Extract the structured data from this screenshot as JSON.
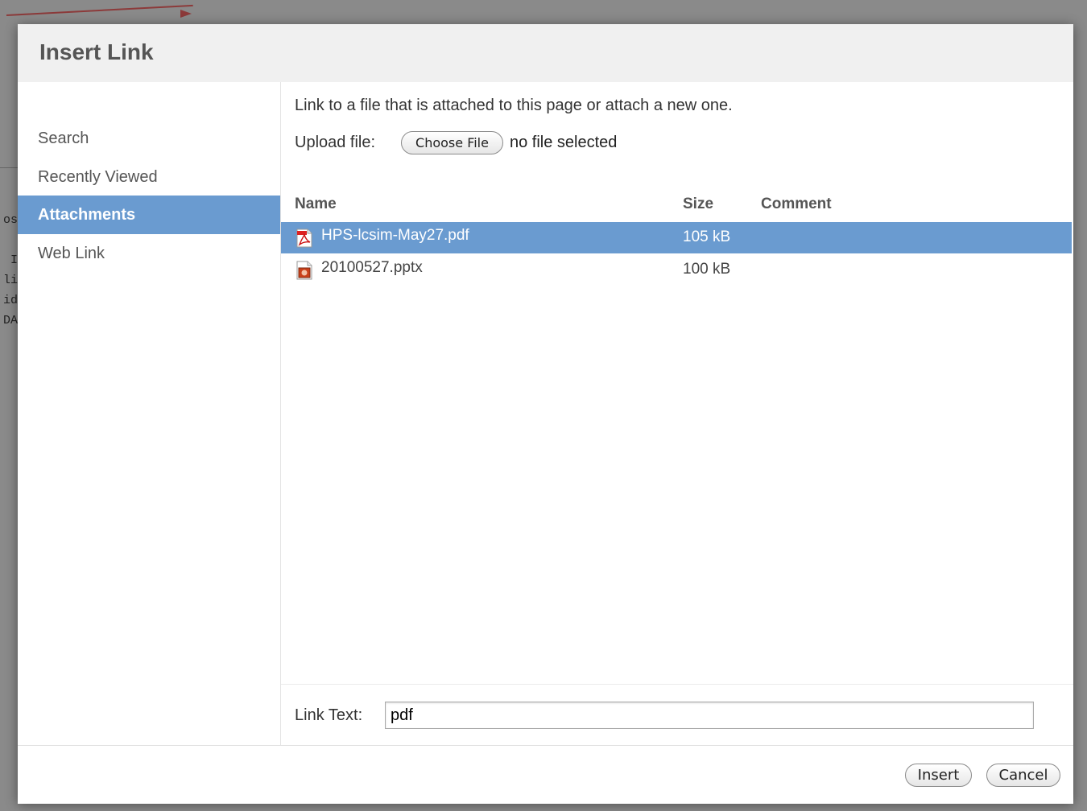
{
  "background": {
    "text_lines": [
      "os",
      "I",
      "li",
      "id",
      "DA"
    ]
  },
  "dialog": {
    "title": "Insert Link"
  },
  "sidebar": {
    "items": [
      {
        "label": "Search",
        "active": false
      },
      {
        "label": "Recently Viewed",
        "active": false
      },
      {
        "label": "Attachments",
        "active": true
      },
      {
        "label": "Web Link",
        "active": false
      }
    ]
  },
  "main": {
    "intro": "Link to a file that is attached to this page or attach a new one.",
    "upload_label": "Upload file:",
    "choose_file_label": "Choose File",
    "no_file_text": "no file selected",
    "columns": {
      "name": "Name",
      "size": "Size",
      "comment": "Comment"
    },
    "files": [
      {
        "name": "HPS-lcsim-May27.pdf",
        "size": "105 kB",
        "comment": "",
        "icon": "pdf-file-icon",
        "selected": true
      },
      {
        "name": "20100527.pptx",
        "size": "100 kB",
        "comment": "",
        "icon": "pptx-file-icon",
        "selected": false
      }
    ],
    "link_text_label": "Link Text:",
    "link_text_value": "pdf"
  },
  "footer": {
    "insert_label": "Insert",
    "cancel_label": "Cancel"
  },
  "colors": {
    "selection": "#6a9bd0",
    "overlay": "#8a8a8a",
    "title_text": "#555555"
  }
}
